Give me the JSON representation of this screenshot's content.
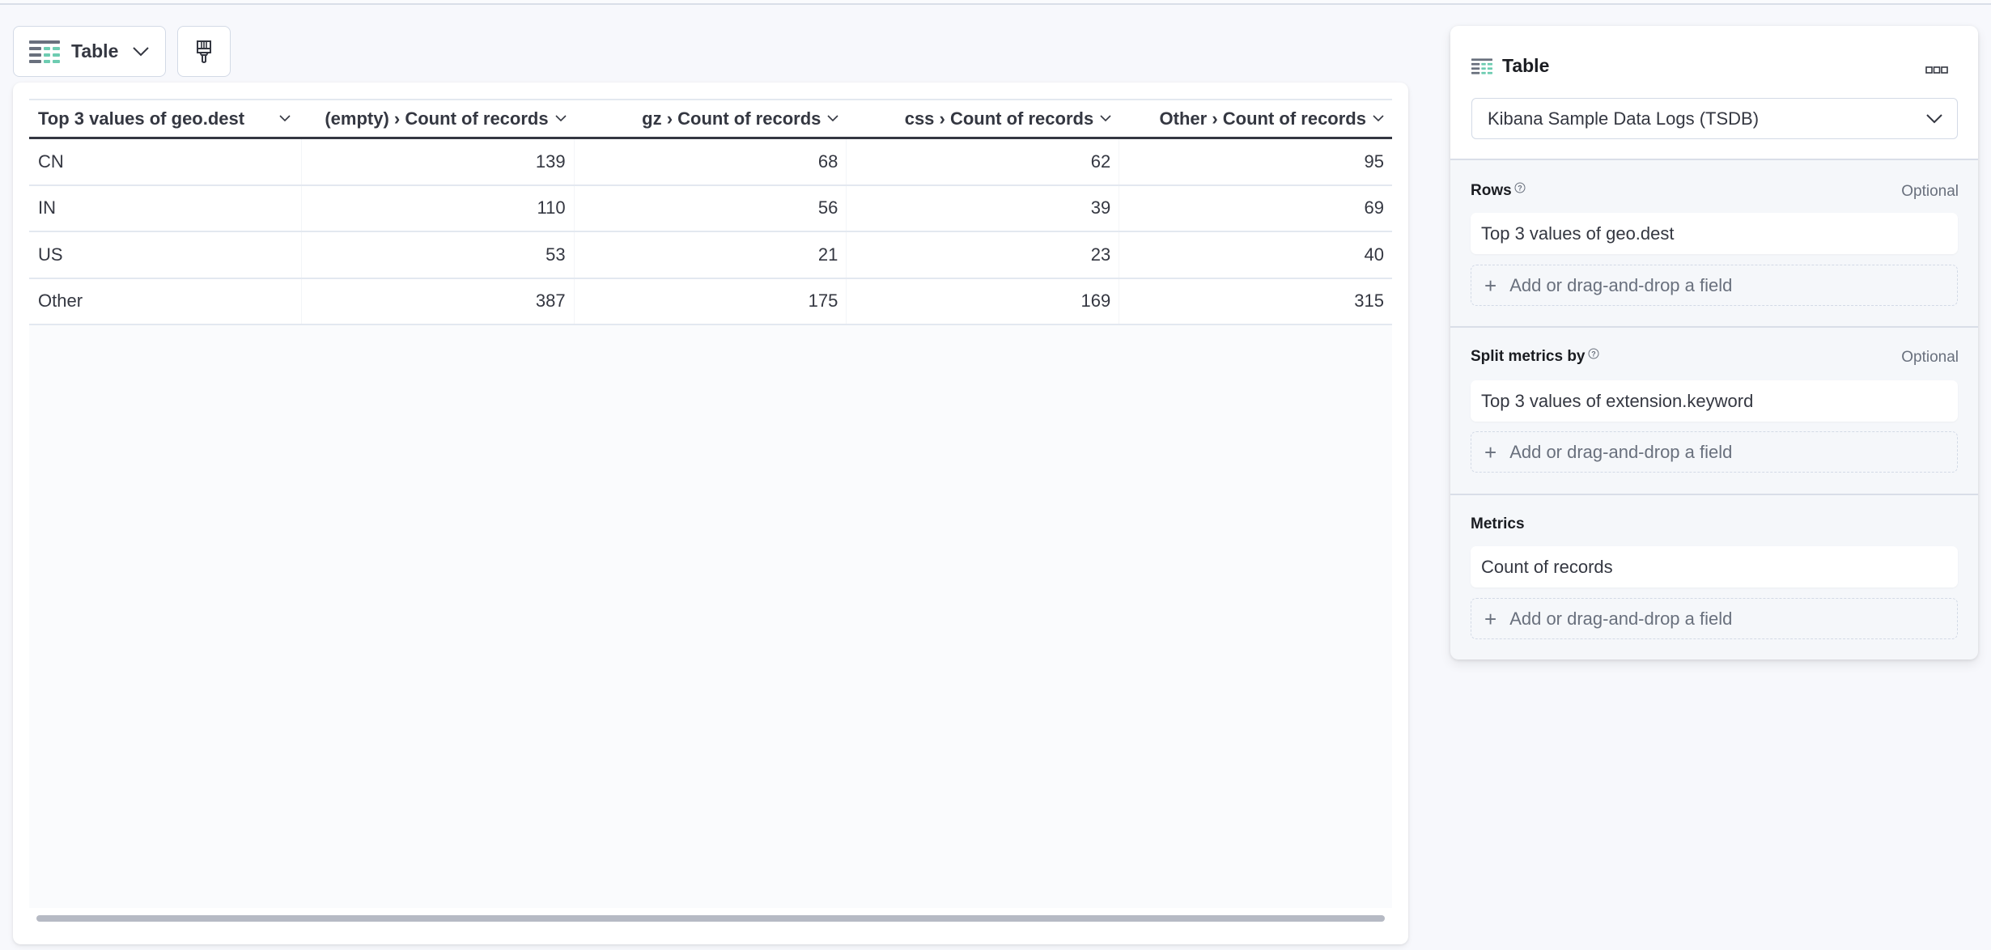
{
  "toolbar": {
    "chart_type_label": "Table",
    "chart_type_icon": "table-vis-icon",
    "style_button_icon": "brush-icon"
  },
  "table": {
    "columns": [
      {
        "label": "Top 3 values of geo.dest",
        "align": "left"
      },
      {
        "label": "(empty) › Count of records",
        "align": "right"
      },
      {
        "label": "gz › Count of records",
        "align": "right"
      },
      {
        "label": "css › Count of records",
        "align": "right"
      },
      {
        "label": "Other › Count of records",
        "align": "right"
      }
    ],
    "rows": [
      [
        "CN",
        "139",
        "68",
        "62",
        "95"
      ],
      [
        "IN",
        "110",
        "56",
        "39",
        "69"
      ],
      [
        "US",
        "53",
        "21",
        "23",
        "40"
      ],
      [
        "Other",
        "387",
        "175",
        "169",
        "315"
      ]
    ]
  },
  "config": {
    "title": "Table",
    "title_icon": "table-vis-icon",
    "more_icon": "boxes-horizontal-icon",
    "data_view": "Kibana Sample Data Logs (TSDB)",
    "sections": {
      "rows": {
        "label": "Rows",
        "optional": "Optional",
        "field": "Top 3 values of geo.dest",
        "add_label": "Add or drag-and-drop a field"
      },
      "split": {
        "label": "Split metrics by",
        "optional": "Optional",
        "field": "Top 3 values of extension.keyword",
        "add_label": "Add or drag-and-drop a field"
      },
      "metrics": {
        "label": "Metrics",
        "field": "Count of records",
        "add_label": "Add or drag-and-drop a field"
      }
    }
  },
  "colors": {
    "icon_gray": "#69707d",
    "icon_green": "#6dccb1",
    "text": "#343741",
    "border": "#d3dae6"
  }
}
